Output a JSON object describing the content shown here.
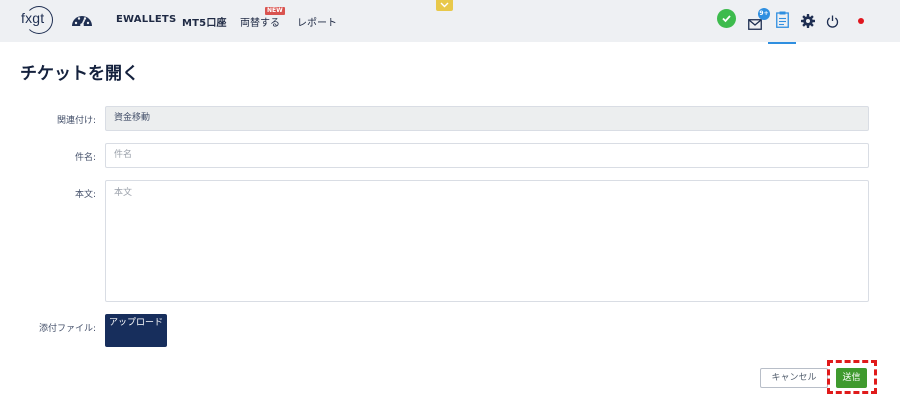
{
  "header": {
    "logo_text": "fxgt",
    "logo_icon": "fxgt-logo",
    "dashboard_icon": "speedometer-icon",
    "nav": [
      {
        "label": "EWALLETS"
      },
      {
        "label": "MT5口座"
      },
      {
        "label": "両替する",
        "badge": "NEW"
      },
      {
        "label": "レポート"
      }
    ],
    "collapse_icon": "chevron-down-icon",
    "verified_icon": "check-circle-icon",
    "mail_badge": "9+",
    "icons": [
      "mail-icon",
      "clipboard-icon",
      "gear-icon",
      "power-icon",
      "japan-flag-icon"
    ],
    "accent_color": "#2f8fe0",
    "badge_color": "#d9534f"
  },
  "form": {
    "title": "チケットを開く",
    "relation_label": "関連付け:",
    "relation_value": "資金移動",
    "subject_label": "件名:",
    "subject_placeholder": "件名",
    "body_label": "本文:",
    "body_placeholder": "本文",
    "attachment_label": "添付ファイル:",
    "upload_label": "アップロード",
    "cancel_label": "キャンセル",
    "submit_label": "送信",
    "submit_color": "#3f9a2e",
    "highlight_color": "#e01a1a"
  }
}
